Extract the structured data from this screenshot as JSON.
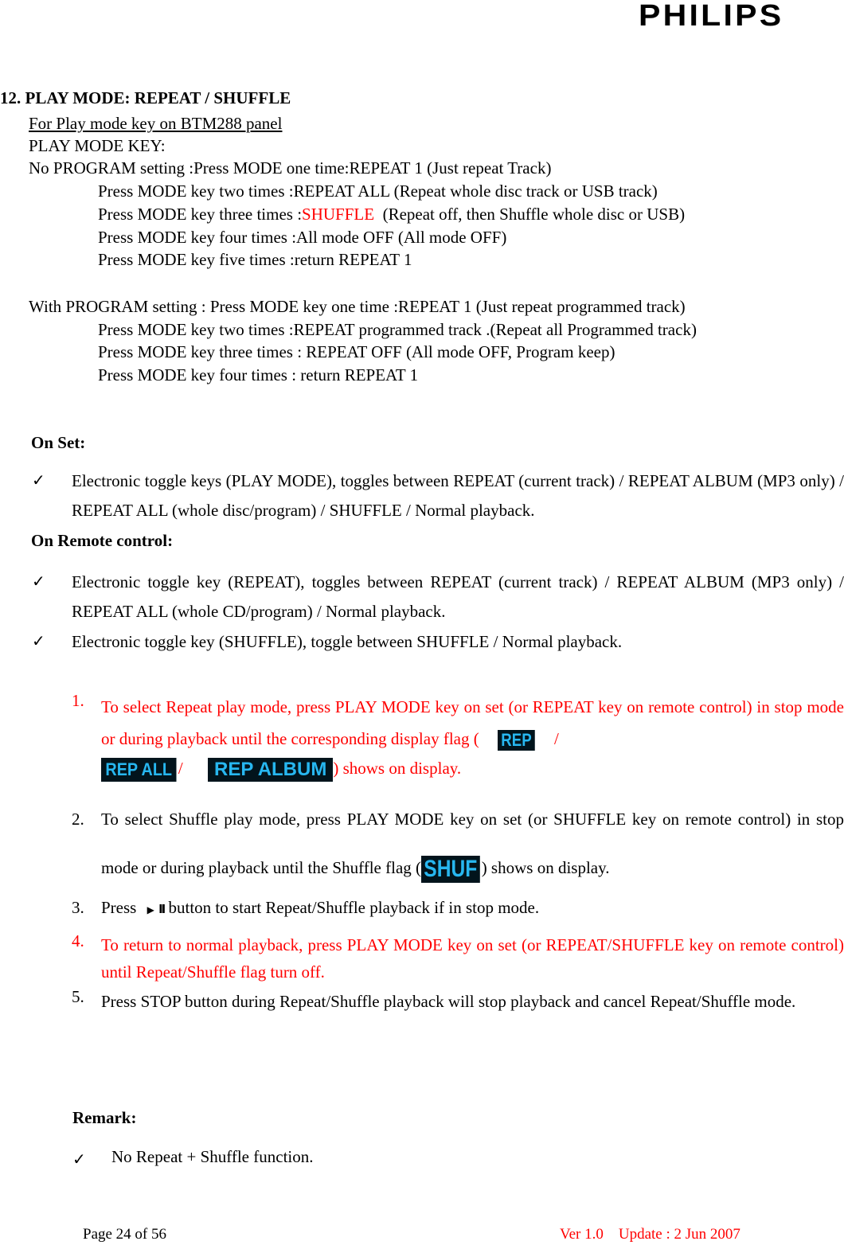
{
  "header": {
    "brand": "PHILIPS"
  },
  "section": {
    "title": "12.  PLAY MODE: REPEAT / SHUFFLE",
    "subtitle": "For Play mode key on BTM288 panel",
    "key_label": "PLAY MODE KEY:",
    "no_program": {
      "first": "No PROGRAM setting :Press MODE one time:REPEAT 1 (Just repeat Track)",
      "lines": [
        "Press MODE key two times :REPEAT ALL (Repeat whole disc track or USB track)",
        "Press MODE key four times :All mode OFF (All mode OFF)",
        "Press MODE key five times :return REPEAT 1"
      ],
      "three_prefix": "Press MODE key three times :",
      "three_highlight": "SHUFFLE",
      "three_suffix": "  (Repeat off, then Shuffle whole disc or USB)"
    },
    "with_program": {
      "first": "With PROGRAM setting : Press MODE key one time :REPEAT 1 (Just repeat programmed track)",
      "lines": [
        "Press MODE key two times :REPEAT programmed track .(Repeat all Programmed track)",
        "Press MODE key three times : REPEAT OFF (All mode OFF, Program keep)",
        "Press MODE key four times : return REPEAT 1"
      ]
    }
  },
  "on_set": {
    "heading": "On Set:",
    "bullets": [
      "Electronic toggle keys (PLAY MODE), toggles between REPEAT (current track) / REPEAT ALBUM (MP3 only) / REPEAT ALL (whole disc/program) / SHUFFLE / Normal playback."
    ]
  },
  "on_remote": {
    "heading": "On Remote control:",
    "bullets": [
      "Electronic toggle key (REPEAT), toggles between REPEAT (current track) / REPEAT ALBUM (MP3 only) / REPEAT ALL (whole CD/program) / Normal playback.",
      "Electronic toggle key (SHUFFLE), toggle between SHUFFLE / Normal playback."
    ]
  },
  "steps": [
    {
      "num": "1.",
      "text_a": "To select Repeat play mode, press PLAY MODE key on set (or REPEAT key on remote control) in stop mode or during playback until the corresponding display flag (",
      "sep": "/",
      "text_b": ") shows on display.",
      "color": "#ff0000"
    },
    {
      "num": "2.",
      "text_a": "To select Shuffle play mode, press PLAY MODE key on set (or SHUFFLE key on remote control) in stop mode or during playback until the Shuffle flag (",
      "text_b": ") shows on display."
    },
    {
      "num": "3.",
      "prefix": "Press",
      "suffix": "button to start Repeat/Shuffle playback if in stop mode."
    },
    {
      "num": "4.",
      "text": "To return to normal playback, press PLAY MODE key on set (or REPEAT/SHUFFLE key on remote control) until Repeat/Shuffle flag turn off.",
      "color": "#ff0000"
    },
    {
      "num": "5.",
      "text": "Press STOP button during Repeat/Shuffle playback will stop playback and cancel Repeat/Shuffle mode."
    }
  ],
  "flags": {
    "rep": "REP",
    "rep_all": "REP ALL",
    "rep_album": "REP ALBUM",
    "shuf": "SHUF",
    "flag_bg": "#02141c",
    "flag_fg": "#27b7f0"
  },
  "remark": {
    "heading": "Remark:",
    "bullets": [
      "No Repeat + Shuffle function."
    ]
  },
  "footer": {
    "page": "Page 24 of 56",
    "version": "Ver 1.0    Update : 2 Jun 2007"
  },
  "icons": {
    "check": "✓",
    "play": "▶",
    "pause": "II"
  }
}
